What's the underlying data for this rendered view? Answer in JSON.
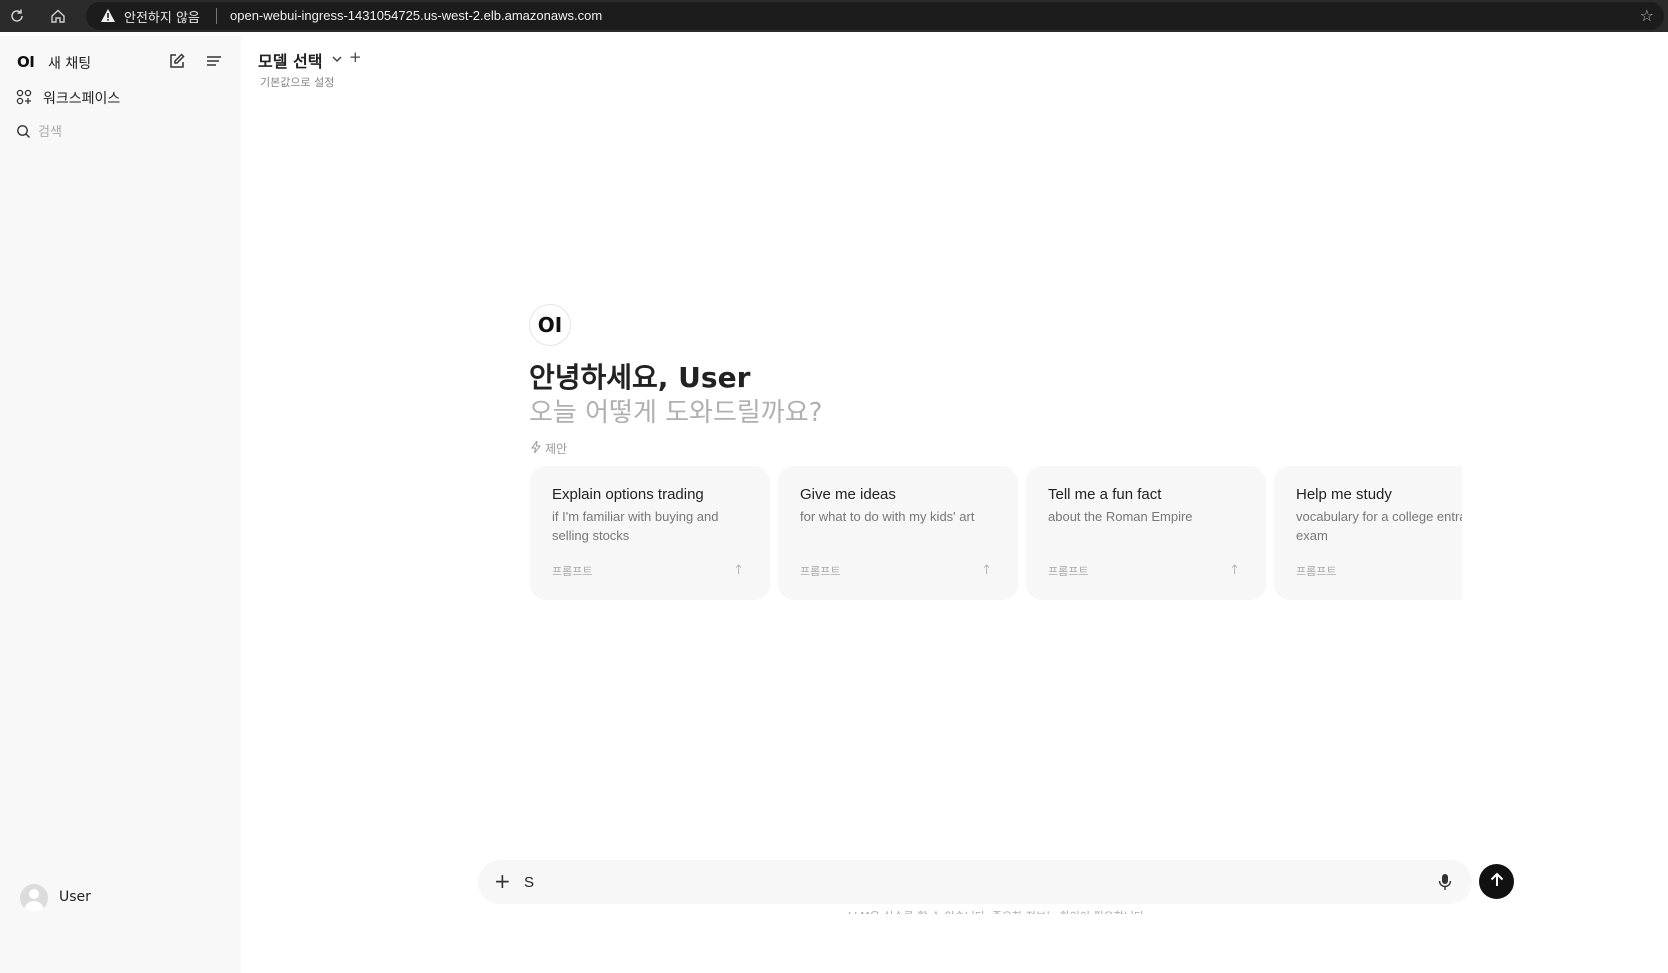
{
  "browser": {
    "security_label": "안전하지 않음",
    "url": "open-webui-ingress-1431054725.us-west-2.elb.amazonaws.com"
  },
  "sidebar": {
    "logo": "OI",
    "new_chat_label": "새 채팅",
    "workspace_label": "워크스페이스",
    "search_placeholder": "검색",
    "user_name": "User"
  },
  "header": {
    "model_select_label": "모델 선택",
    "set_default_label": "기본값으로 설정"
  },
  "hero": {
    "logo": "OI",
    "greeting": "안녕하세요, User",
    "subtitle": "오늘 어떻게 도와드릴까요?",
    "suggestions_label": "제안"
  },
  "suggestions": [
    {
      "title": "Explain options trading",
      "subtitle": "if I'm familiar with buying and selling stocks",
      "tag": "프롬프트"
    },
    {
      "title": "Give me ideas",
      "subtitle": "for what to do with my kids' art",
      "tag": "프롬프트"
    },
    {
      "title": "Tell me a fun fact",
      "subtitle": "about the Roman Empire",
      "tag": "프롬프트"
    },
    {
      "title": "Help me study",
      "subtitle": "vocabulary for a college entrance exam",
      "tag": "프롬프트"
    }
  ],
  "composer": {
    "value": "S",
    "disclaimer": "LLM은 실수를 할 수 있습니다. 중요한 정보는 확인이 필요합니다."
  },
  "colors": {
    "sidebar_bg": "#f8f8f8",
    "card_bg": "#f7f7f7",
    "send_button": "#111111"
  }
}
